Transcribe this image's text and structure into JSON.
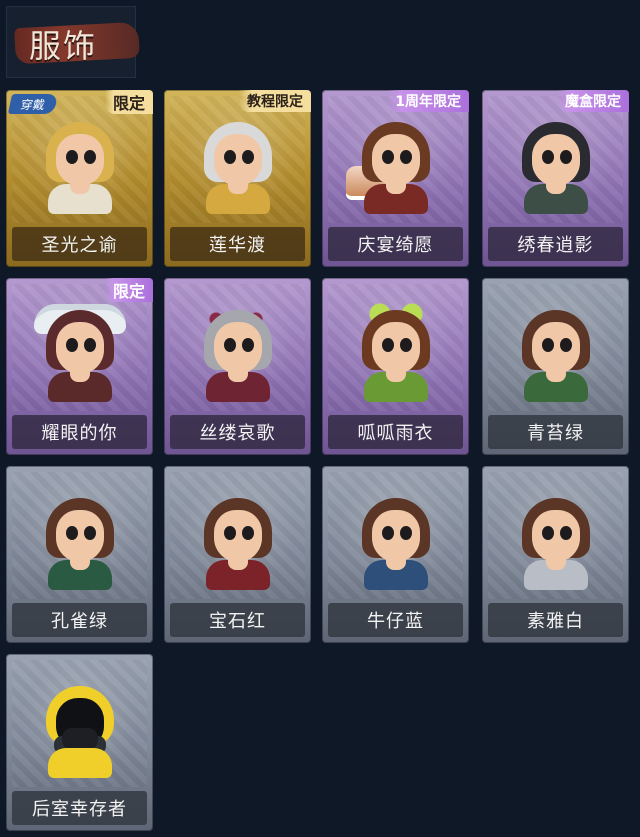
{
  "header": {
    "title": "服饰"
  },
  "cards": [
    {
      "name": "圣光之谕",
      "tier": "gold",
      "badge": "限定",
      "wearing": "穿戴",
      "variant": "v-gold"
    },
    {
      "name": "莲华渡",
      "tier": "gold",
      "badge": "教程限定",
      "variant": "v-gold2"
    },
    {
      "name": "庆宴绮愿",
      "tier": "purple",
      "badge": "1周年限定",
      "variant": "v-cake"
    },
    {
      "name": "绣春逍影",
      "tier": "purple",
      "badge": "魔盒限定",
      "variant": "v-wind"
    },
    {
      "name": "耀眼的你",
      "tier": "purple",
      "badge": "限定",
      "variant": "v-hat"
    },
    {
      "name": "丝缕哀歌",
      "tier": "purple",
      "variant": "v-lace"
    },
    {
      "name": "呱呱雨衣",
      "tier": "purple",
      "variant": "v-frog"
    },
    {
      "name": "青苔绿",
      "tier": "grey",
      "variant": "v-green"
    },
    {
      "name": "孔雀绿",
      "tier": "grey",
      "variant": "v-peacock"
    },
    {
      "name": "宝石红",
      "tier": "grey",
      "variant": "v-ruby"
    },
    {
      "name": "牛仔蓝",
      "tier": "grey",
      "variant": "v-denim"
    },
    {
      "name": "素雅白",
      "tier": "grey",
      "variant": "v-white"
    },
    {
      "name": "后室幸存者",
      "tier": "grey",
      "variant": "v-survivor"
    }
  ]
}
